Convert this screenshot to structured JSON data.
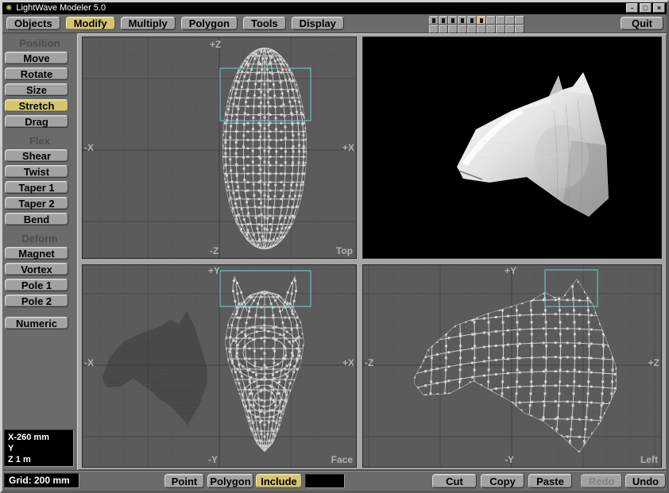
{
  "window": {
    "title": "LightWave Modeler 5.0",
    "controls": {
      "minimize": "-",
      "maximize": "□",
      "close": "×"
    }
  },
  "menubar": {
    "tabs": [
      {
        "label": "Objects",
        "active": false
      },
      {
        "label": "Modify",
        "active": true
      },
      {
        "label": "Multiply",
        "active": false
      },
      {
        "label": "Polygon",
        "active": false
      },
      {
        "label": "Tools",
        "active": false
      },
      {
        "label": "Display",
        "active": false
      }
    ],
    "quit": "Quit"
  },
  "mini_toolbar": {
    "rows": 2,
    "cols": 10,
    "marked_top_cells": [
      0,
      1,
      2,
      3,
      4,
      5
    ],
    "active_cell": 5
  },
  "sidebar": {
    "sections": [
      {
        "label": "Position",
        "buttons": [
          {
            "label": "Move",
            "active": false
          },
          {
            "label": "Rotate",
            "active": false
          },
          {
            "label": "Size",
            "active": false
          },
          {
            "label": "Stretch",
            "active": true
          },
          {
            "label": "Drag",
            "active": false
          }
        ]
      },
      {
        "label": "Flex",
        "buttons": [
          {
            "label": "Shear",
            "active": false
          },
          {
            "label": "Twist",
            "active": false
          },
          {
            "label": "Taper 1",
            "active": false
          },
          {
            "label": "Taper 2",
            "active": false
          },
          {
            "label": "Bend",
            "active": false
          }
        ]
      },
      {
        "label": "Deform",
        "buttons": [
          {
            "label": "Magnet",
            "active": false
          },
          {
            "label": "Vortex",
            "active": false
          },
          {
            "label": "Pole 1",
            "active": false
          },
          {
            "label": "Pole 2",
            "active": false
          }
        ]
      }
    ],
    "numeric": "Numeric",
    "coordinates": {
      "line1": "X-260 mm",
      "line2": "Y",
      "line3": "Z 1 m"
    }
  },
  "viewports": {
    "top": {
      "name": "Top",
      "axis_top": "+Z",
      "axis_left": "-X",
      "axis_right": "+X",
      "axis_bottom": "-Z"
    },
    "face": {
      "name": "Face",
      "axis_top": "+Y",
      "axis_left": "-X",
      "axis_right": "+X",
      "axis_bottom": "-Y"
    },
    "left": {
      "name": "Left",
      "axis_top": "+Y",
      "axis_left": "-Z",
      "axis_right": "+Z",
      "axis_bottom": "-Y"
    }
  },
  "statusbar": {
    "grid": "Grid: 200 mm",
    "modes": [
      {
        "label": "Point",
        "active": false
      },
      {
        "label": "Polygon",
        "active": false
      },
      {
        "label": "Include",
        "active": true
      }
    ],
    "edits": [
      {
        "label": "Cut",
        "enabled": true
      },
      {
        "label": "Copy",
        "enabled": true
      },
      {
        "label": "Paste",
        "enabled": true
      },
      {
        "label": "Redo",
        "enabled": false
      },
      {
        "label": "Undo",
        "enabled": true
      }
    ]
  },
  "colors": {
    "highlight": "#d5c570",
    "selection_box": "#72d2d2",
    "viewport_bg": "#5b5b5b",
    "ui_gray": "#6b6b6b",
    "wireframe": "#c8c8c8",
    "selected_point": "#d25a5a"
  }
}
